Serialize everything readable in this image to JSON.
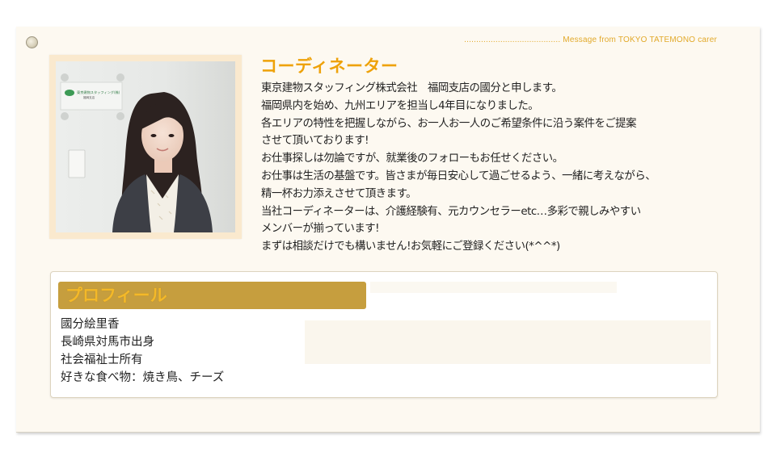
{
  "header": {
    "tagline": "........................................ Message from TOKYO TATEMONO carer"
  },
  "coordinator": {
    "heading": "コーディネーター",
    "message_lines": [
      "東京建物スタッフィング株式会社　福岡支店の國分と申します。",
      "福岡県内を始め、九州エリアを担当し4年目になりました。",
      "各エリアの特性を把握しながら、お一人お一人のご希望条件に沿う案件をご提案",
      "させて頂いております!",
      "お仕事探しは勿論ですが、就業後のフォローもお任せください。",
      "お仕事は生活の基盤です。皆さまが毎日安心して過ごせるよう、一緒に考えながら、",
      "精一杯お力添えさせて頂きます。",
      "当社コーディネーターは、介護経験有、元カウンセラーetc…多彩で親しみやすい",
      "メンバーが揃っています!",
      "まずは相談だけでも構いません!お気軽にご登録ください(*^^*)"
    ],
    "photo_logo_line1": "東京建物スタッフィング(株)",
    "photo_logo_line2": "福岡支店"
  },
  "profile": {
    "title": "プロフィール",
    "lines": [
      "國分絵里香",
      "長崎県対馬市出身",
      "社会福祉士所有",
      "好きな食べ物：焼き鳥、チーズ"
    ]
  },
  "colors": {
    "accent_orange": "#eea20a",
    "profile_bar": "#c69e3e",
    "profile_title_text": "#f4b928",
    "card_bg": "#fdf9f1"
  }
}
